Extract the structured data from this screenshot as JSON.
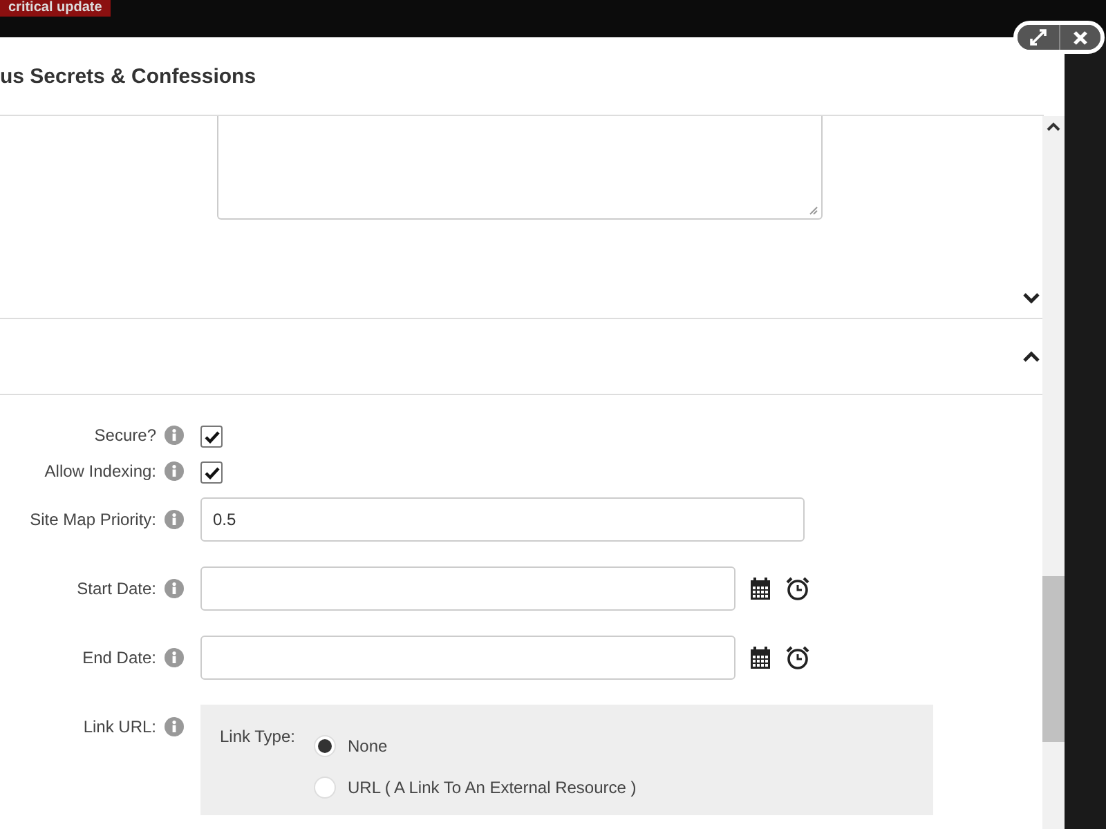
{
  "top_bar": {
    "badge": "critical update"
  },
  "dialog": {
    "title": "us Secrets & Confessions"
  },
  "sections": [
    {
      "expanded": false
    },
    {
      "expanded": true
    }
  ],
  "fields": [
    {
      "kind": "checkbox",
      "label": "Secure?",
      "checked": true
    },
    {
      "kind": "checkbox",
      "label": "Allow Indexing:",
      "checked": true
    },
    {
      "kind": "text",
      "label": "Site Map Priority:",
      "value": "0.5"
    },
    {
      "kind": "datetime",
      "label": "Start Date:"
    },
    {
      "kind": "datetime",
      "label": "End Date:"
    },
    {
      "kind": "link",
      "label": "Link URL:",
      "link_type_label": "Link Type:",
      "options": [
        {
          "label": "None",
          "selected": true
        },
        {
          "label": "URL ( A Link To An External Resource )",
          "selected": false
        }
      ]
    }
  ]
}
